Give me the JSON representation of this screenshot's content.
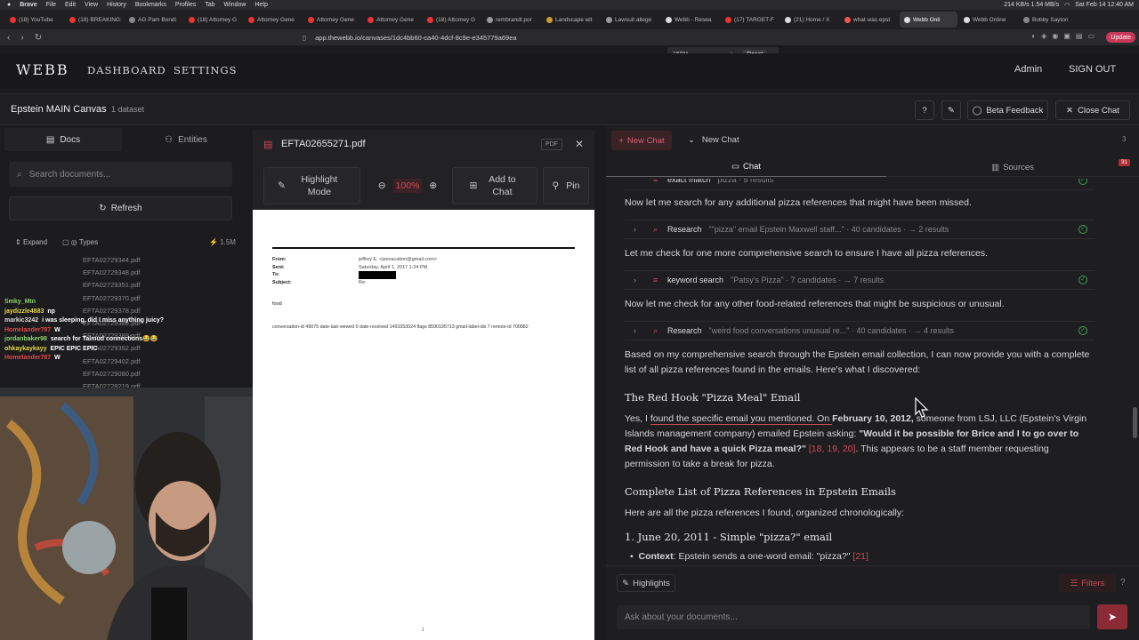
{
  "macbar": {
    "menus": [
      "Brave",
      "File",
      "Edit",
      "View",
      "History",
      "Bookmarks",
      "Profiles",
      "Tab",
      "Window",
      "Help"
    ],
    "clock": "Sat Feb 14  12:40 AM",
    "net": "214 KB/s 1.54 MB/s"
  },
  "browser_tabs": [
    {
      "label": "(18) YouTube",
      "color": "#e33"
    },
    {
      "label": "(18) BREAKING:",
      "color": "#e33"
    },
    {
      "label": "AG Pam Bondi",
      "color": "#888"
    },
    {
      "label": "(18) Attorney G",
      "color": "#e33"
    },
    {
      "label": "Attorney Gene",
      "color": "#e33"
    },
    {
      "label": "Attorney Gene",
      "color": "#e33"
    },
    {
      "label": "Attorney Gene",
      "color": "#e33"
    },
    {
      "label": "(18) Attorney G",
      "color": "#e33"
    },
    {
      "label": "rembrandt por",
      "color": "#999"
    },
    {
      "label": "Landscape wit",
      "color": "#c93"
    },
    {
      "label": "Lawsuit allege",
      "color": "#999"
    },
    {
      "label": "Webb - Resea",
      "color": "#ddd"
    },
    {
      "label": "(17) TARGET-F",
      "color": "#e33"
    },
    {
      "label": "(21) Home / X",
      "color": "#ddd"
    },
    {
      "label": "what was epst",
      "color": "#e55"
    },
    {
      "label": "Webb Onli",
      "color": "#ddd"
    },
    {
      "label": "Webb Online",
      "color": "#ddd"
    },
    {
      "label": "Bobby Sayton",
      "color": "#888"
    }
  ],
  "address": {
    "url": "app.thewebb.io/canvases/1dc4bb60-ca40-4dcf-8c9e-e345779a69ea",
    "update_label": "Update"
  },
  "zoom": {
    "level": "160%",
    "minus": "−",
    "plus": "+",
    "reset": "Reset"
  },
  "nav": {
    "logo": "WEBB",
    "dashboard": "DASHBOARD",
    "settings": "SETTINGS",
    "admin": "Admin",
    "signout": "SIGN OUT"
  },
  "canvas": {
    "title": "Epstein MAIN Canvas",
    "datasets": "1 dataset",
    "beta_feedback": "Beta Feedback",
    "close_chat": "Close Chat"
  },
  "left": {
    "tab_docs": "Docs",
    "tab_entities": "Entities",
    "search_placeholder": "Search documents...",
    "refresh": "Refresh",
    "expand": "Expand",
    "types": "Types",
    "count": "1.5M",
    "files": [
      "EFTA02729344.pdf",
      "EFTA02729348.pdf",
      "EFTA02729351.pdf",
      "EFTA02729370.pdf",
      "EFTA02729378.pdf",
      "EFTA02729385.pdf",
      "EFTA02729389.pdf",
      "EFTA02729392.pdf",
      "EFTA02729402.pdf",
      "EFTA02729080.pdf",
      "EFTA02728219.pdf"
    ]
  },
  "stream_chat": [
    {
      "user": "Smky_Mtn",
      "msg": "",
      "color": "#8fd46a"
    },
    {
      "user": "jaydizzle4883",
      "msg": "np",
      "color": "#e4d84a"
    },
    {
      "user": "markic3242",
      "msg": "i was sleeping, did I miss anything juicy?",
      "color": "#ddd"
    },
    {
      "user": "Homelander787",
      "msg": "W",
      "color": "#e04848"
    },
    {
      "user": "jordanbaker98",
      "msg": "search for Talmud connections😂😂",
      "color": "#8fd46a"
    },
    {
      "user": "ohkaykaykayy",
      "msg": "EPIC EPIC EPIC",
      "color": "#e4d84a"
    },
    {
      "user": "Homelander787",
      "msg": "W",
      "color": "#e04848"
    }
  ],
  "pdf": {
    "filename": "EFTA02655271.pdf",
    "badge": "PDF",
    "highlight_mode": "Highlight Mode",
    "zoom": "100%",
    "add_to_chat": "Add to Chat",
    "pin": "Pin",
    "email": {
      "from_label": "From:",
      "from": "jeffrey E. <jeevacation@gmail.com>",
      "sent_label": "Sent:",
      "sent": "Saturday, April 1, 2017 1:24 PM",
      "to_label": "To:",
      "subject_label": "Subject:",
      "subject": "Re:",
      "body": "food",
      "meta": "conversation-id 49075 date-last-viewed 0 date-received 1491053024 flags 8590195713 gmail-label-ids 7 remote-id 700882",
      "page": "1"
    }
  },
  "chat": {
    "new_chat_btn": "New Chat",
    "current": "New Chat",
    "count": "3",
    "tab_chat": "Chat",
    "tab_sources": "Sources",
    "sources_badge": "31",
    "partial_row": {
      "name": "exact match",
      "query": "pizza · 5 results"
    },
    "p1": "Now let me search for any additional pizza references that might have been missed.",
    "row1": {
      "name": "Research",
      "query": "\"\"pizza\" email Epstein Maxwell staff...\" · 40 candidates · → 2 results"
    },
    "p2": "Let me check for one more comprehensive search to ensure I have all pizza references.",
    "row2": {
      "name": "keyword search",
      "query": "\"Patsy's Pizza\" · 7 candidates · → 7 results"
    },
    "p3": "Now let me check for any other food-related references that might be suspicious or unusual.",
    "row3": {
      "name": "Research",
      "query": "\"weird food conversations unusual re...\" · 40 candidates · → 4 results"
    },
    "p4": "Based on my comprehensive search through the Epstein email collection, I can now provide you with a complete list of all pizza references found in the emails. Here's what I discovered:",
    "h_redhook": "The Red Hook \"Pizza Meal\" Email",
    "p5_a": "Yes, I ",
    "p5_hl": "found the specific email you mentioned. On ",
    "p5_date": "February 10, 2012,",
    "p5_b": " someone from LSJ, LLC (Epstein's Virgin Islands management company) emailed Epstein asking: ",
    "p5_quote": "\"Would it be possible for Brice and I to go over to Red Hook and have a quick Pizza meal?\"",
    "p5_refs": " [18, 19, 20]",
    "p5_c": ". This appears to be a staff member requesting permission to take a break for pizza.",
    "h_complete": "Complete List of Pizza References in Epstein Emails",
    "p6": "Here are all the pizza references I found, organized chronologically:",
    "h_item1": "1. June 20, 2011 - Simple \"pizza?\" email",
    "bullet_label": "Context",
    "bullet_text": ": Epstein sends a one-word email: \"pizza?\" ",
    "bullet_ref": "[21]",
    "highlights": "Highlights",
    "filters": "Filters",
    "input_placeholder": "Ask about your documents..."
  }
}
